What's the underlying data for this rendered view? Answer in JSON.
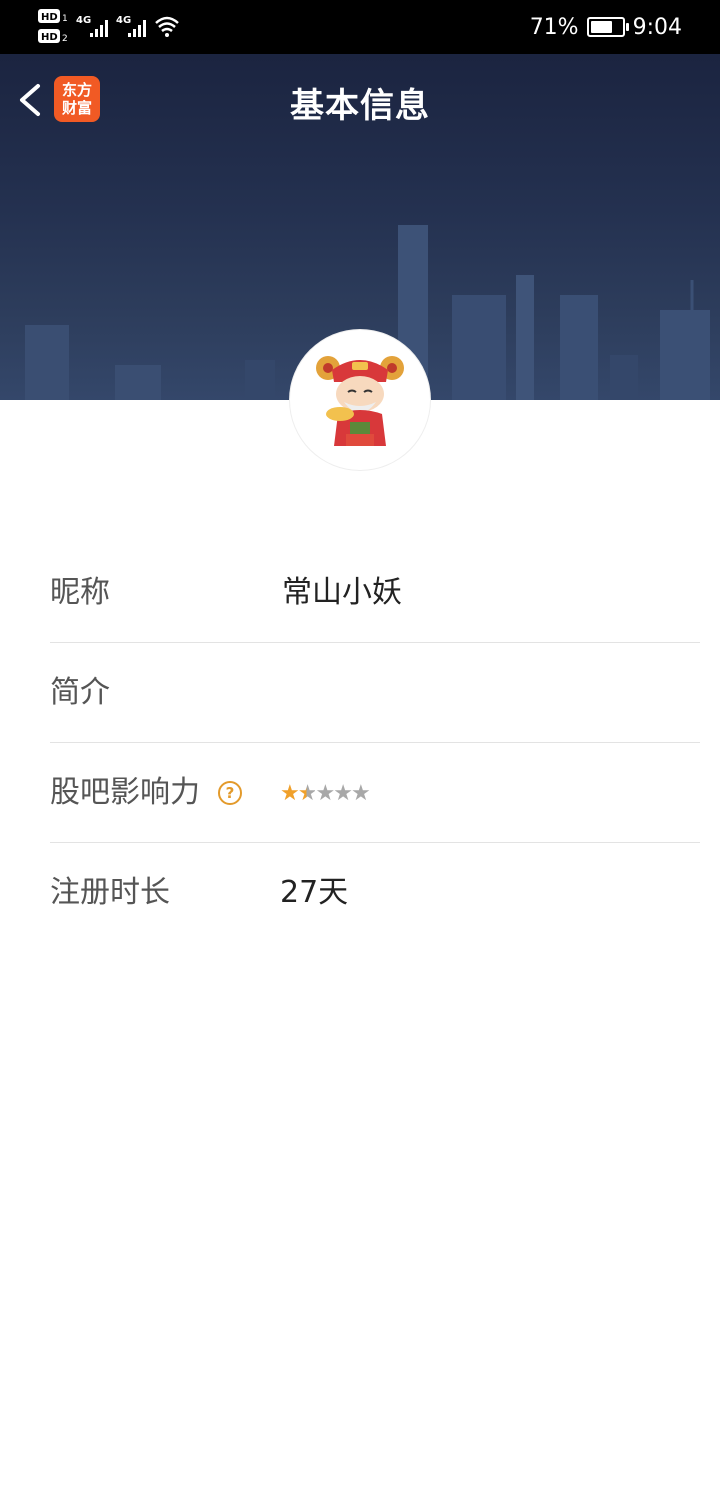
{
  "status_bar": {
    "left_badges": [
      "HD",
      "HD",
      "4G",
      "4G"
    ],
    "battery_percent": "71%",
    "battery_level": 0.71,
    "time": "9:04"
  },
  "header": {
    "title": "基本信息",
    "logo_line1": "东方",
    "logo_line2": "财富"
  },
  "profile": {
    "rows": [
      {
        "label": "昵称",
        "value": "常山小妖"
      },
      {
        "label": "简介",
        "value": ""
      },
      {
        "label": "股吧影响力",
        "help": "?",
        "rating": 1.5,
        "rating_max": 5
      },
      {
        "label": "注册时长",
        "value": "27天"
      }
    ]
  },
  "colors": {
    "accent_orange": "#f0a02a",
    "logo_orange": "#f15a24",
    "banner_dark": "#1b2440"
  }
}
